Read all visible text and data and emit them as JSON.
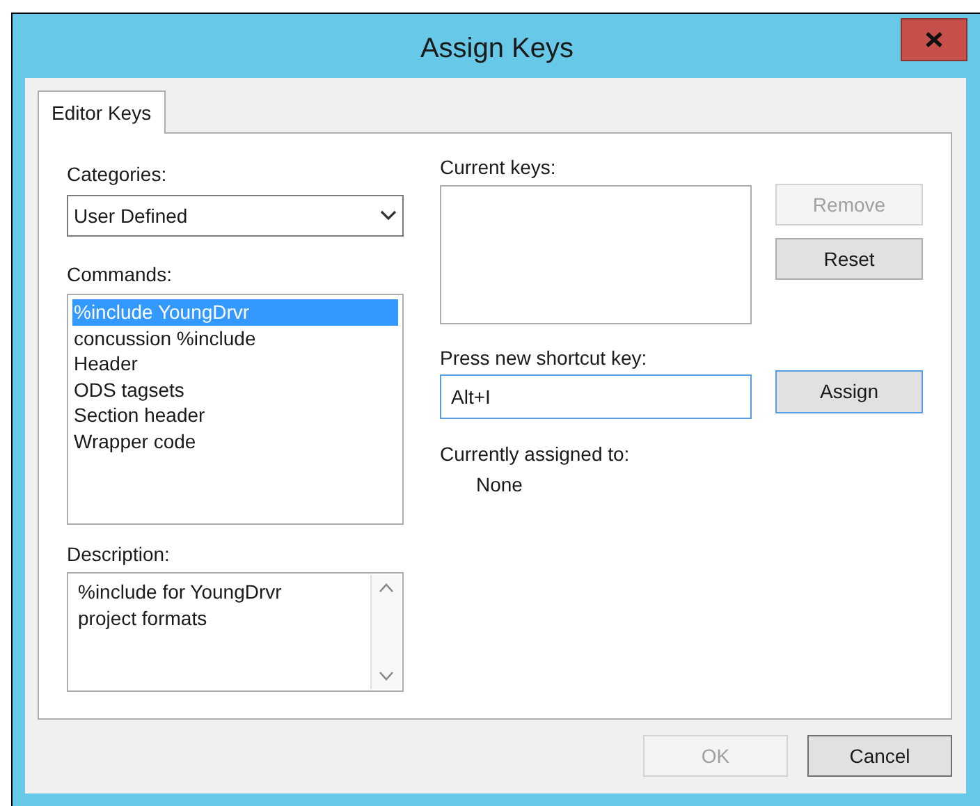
{
  "window": {
    "title": "Assign Keys"
  },
  "tabs": [
    {
      "label": "Editor Keys",
      "selected": true
    }
  ],
  "categories": {
    "label": "Categories:",
    "value": "User Defined"
  },
  "commands": {
    "label": "Commands:",
    "items": [
      {
        "label": "%include YoungDrvr",
        "selected": true
      },
      {
        "label": "concussion %include",
        "selected": false
      },
      {
        "label": "Header",
        "selected": false
      },
      {
        "label": "ODS tagsets",
        "selected": false
      },
      {
        "label": "Section header",
        "selected": false
      },
      {
        "label": "Wrapper code",
        "selected": false
      }
    ]
  },
  "description": {
    "label": "Description:",
    "lines": [
      "%include for YoungDrvr",
      "project formats"
    ]
  },
  "current_keys": {
    "label": "Current keys:"
  },
  "key_buttons": [
    {
      "label": "Remove",
      "disabled": true
    },
    {
      "label": "Reset",
      "disabled": false
    }
  ],
  "new_shortcut": {
    "label": "Press new shortcut key:",
    "value": "Alt+I"
  },
  "assign_button": {
    "label": "Assign",
    "disabled": false
  },
  "currently_assigned": {
    "label": "Currently assigned to:",
    "value": "None"
  },
  "dialog_buttons": [
    {
      "label": "OK",
      "disabled": true
    },
    {
      "label": "Cancel",
      "disabled": false
    }
  ]
}
